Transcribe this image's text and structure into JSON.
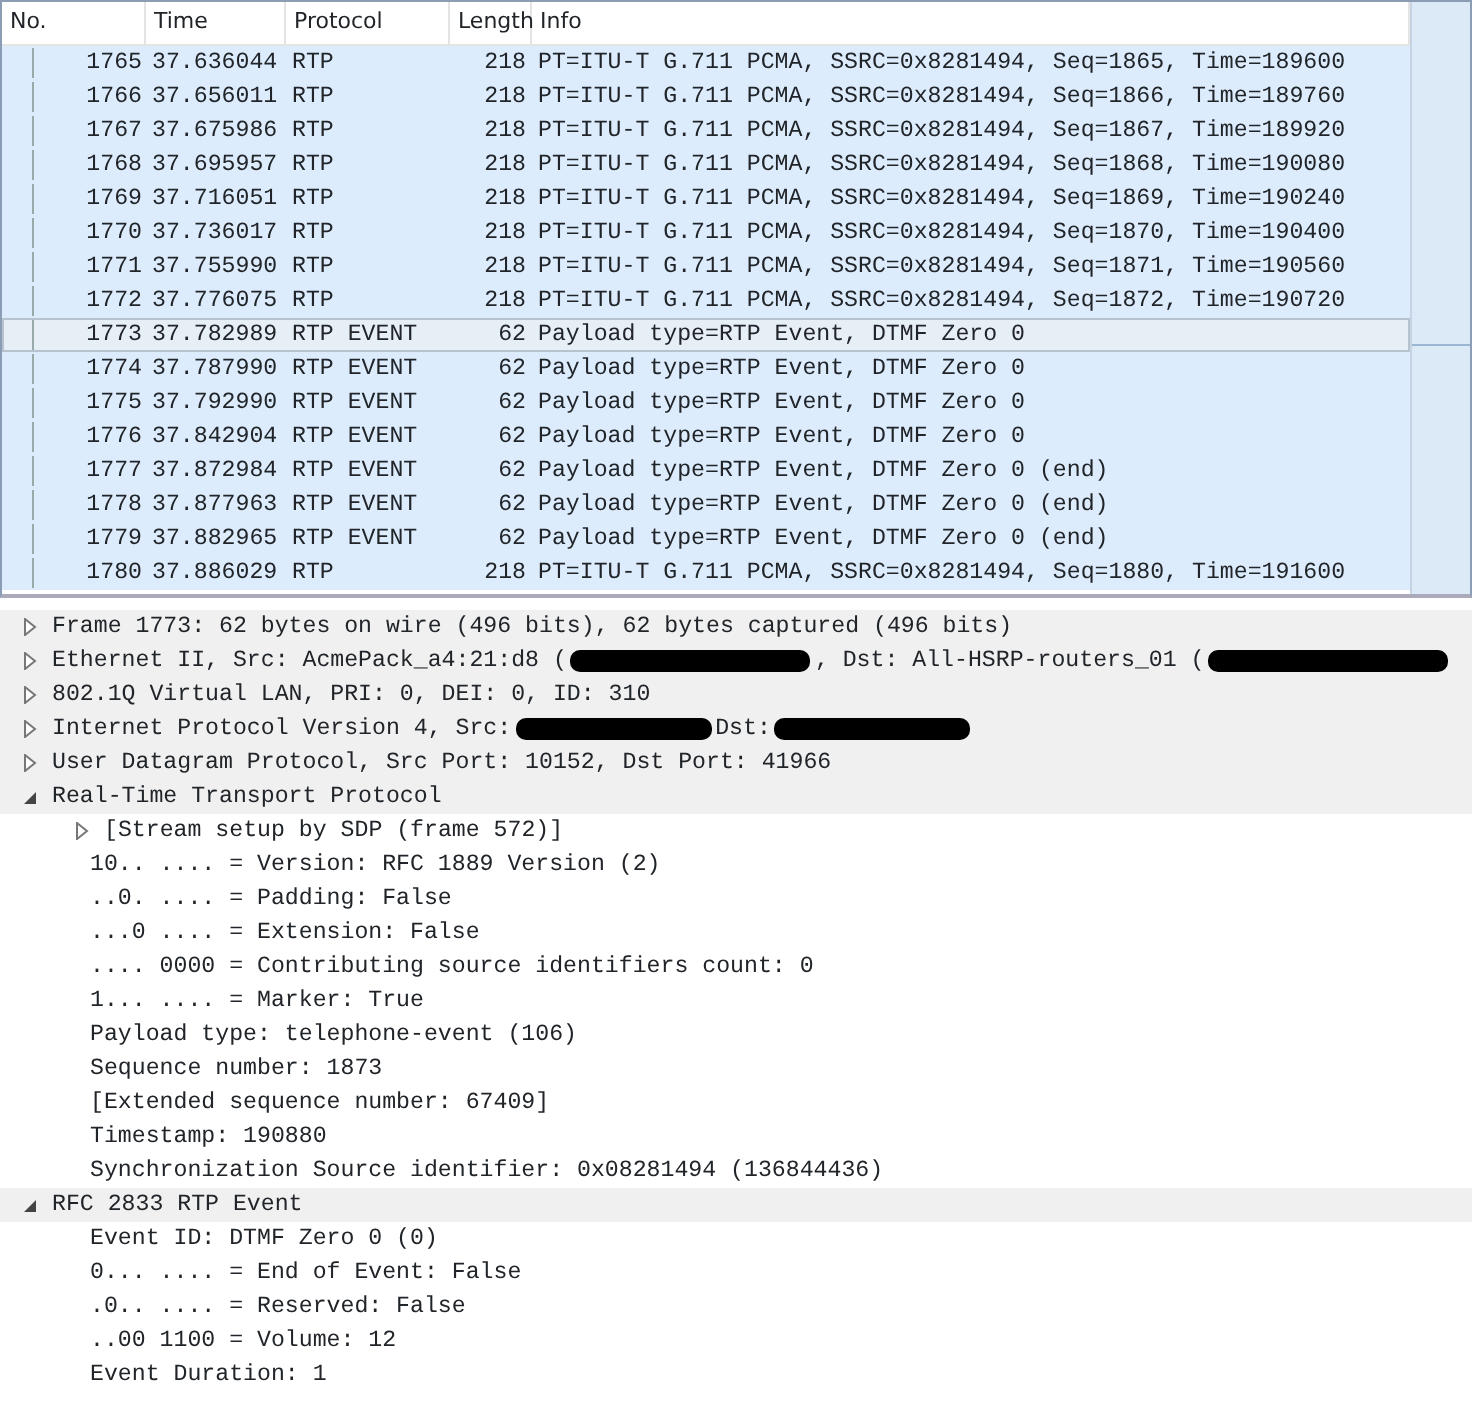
{
  "packet_list": {
    "columns": [
      "No.",
      "Time",
      "Protocol",
      "Length",
      "Info"
    ],
    "rows": [
      {
        "no": "1765",
        "time": "37.636044",
        "protocol": "RTP",
        "length": "218",
        "info": "PT=ITU-T G.711 PCMA, SSRC=0x8281494, Seq=1865, Time=189600",
        "selected": false
      },
      {
        "no": "1766",
        "time": "37.656011",
        "protocol": "RTP",
        "length": "218",
        "info": "PT=ITU-T G.711 PCMA, SSRC=0x8281494, Seq=1866, Time=189760",
        "selected": false
      },
      {
        "no": "1767",
        "time": "37.675986",
        "protocol": "RTP",
        "length": "218",
        "info": "PT=ITU-T G.711 PCMA, SSRC=0x8281494, Seq=1867, Time=189920",
        "selected": false
      },
      {
        "no": "1768",
        "time": "37.695957",
        "protocol": "RTP",
        "length": "218",
        "info": "PT=ITU-T G.711 PCMA, SSRC=0x8281494, Seq=1868, Time=190080",
        "selected": false
      },
      {
        "no": "1769",
        "time": "37.716051",
        "protocol": "RTP",
        "length": "218",
        "info": "PT=ITU-T G.711 PCMA, SSRC=0x8281494, Seq=1869, Time=190240",
        "selected": false
      },
      {
        "no": "1770",
        "time": "37.736017",
        "protocol": "RTP",
        "length": "218",
        "info": "PT=ITU-T G.711 PCMA, SSRC=0x8281494, Seq=1870, Time=190400",
        "selected": false
      },
      {
        "no": "1771",
        "time": "37.755990",
        "protocol": "RTP",
        "length": "218",
        "info": "PT=ITU-T G.711 PCMA, SSRC=0x8281494, Seq=1871, Time=190560",
        "selected": false
      },
      {
        "no": "1772",
        "time": "37.776075",
        "protocol": "RTP",
        "length": "218",
        "info": "PT=ITU-T G.711 PCMA, SSRC=0x8281494, Seq=1872, Time=190720",
        "selected": false
      },
      {
        "no": "1773",
        "time": "37.782989",
        "protocol": "RTP EVENT",
        "length": "62",
        "info": "Payload type=RTP Event, DTMF Zero 0",
        "selected": true
      },
      {
        "no": "1774",
        "time": "37.787990",
        "protocol": "RTP EVENT",
        "length": "62",
        "info": "Payload type=RTP Event, DTMF Zero 0",
        "selected": false
      },
      {
        "no": "1775",
        "time": "37.792990",
        "protocol": "RTP EVENT",
        "length": "62",
        "info": "Payload type=RTP Event, DTMF Zero 0",
        "selected": false
      },
      {
        "no": "1776",
        "time": "37.842904",
        "protocol": "RTP EVENT",
        "length": "62",
        "info": "Payload type=RTP Event, DTMF Zero 0",
        "selected": false
      },
      {
        "no": "1777",
        "time": "37.872984",
        "protocol": "RTP EVENT",
        "length": "62",
        "info": "Payload type=RTP Event, DTMF Zero 0 (end)",
        "selected": false
      },
      {
        "no": "1778",
        "time": "37.877963",
        "protocol": "RTP EVENT",
        "length": "62",
        "info": "Payload type=RTP Event, DTMF Zero 0 (end)",
        "selected": false
      },
      {
        "no": "1779",
        "time": "37.882965",
        "protocol": "RTP EVENT",
        "length": "62",
        "info": "Payload type=RTP Event, DTMF Zero 0 (end)",
        "selected": false
      },
      {
        "no": "1780",
        "time": "37.886029",
        "protocol": "RTP",
        "length": "218",
        "info": "PT=ITU-T G.711 PCMA, SSRC=0x8281494, Seq=1880, Time=191600",
        "selected": false
      }
    ]
  },
  "details": [
    {
      "segments": [
        {
          "kind": "text",
          "text": "Frame 1773: 62 bytes on wire (496 bits), 62 bytes captured (496 bits)"
        }
      ],
      "expanded": false
    },
    {
      "segments": [
        {
          "kind": "text",
          "text": "Ethernet II, Src: AcmePack_a4:21:d8 ("
        },
        {
          "kind": "redacted"
        },
        {
          "kind": "text",
          "text": ", Dst: All-HSRP-routers_01 ("
        },
        {
          "kind": "redacted"
        }
      ],
      "expanded": false
    },
    {
      "segments": [
        {
          "kind": "text",
          "text": "802.1Q Virtual LAN, PRI: 0, DEI: 0, ID: 310"
        }
      ],
      "expanded": false
    },
    {
      "segments": [
        {
          "kind": "text",
          "text": "Internet Protocol Version 4, Src:"
        },
        {
          "kind": "redacted"
        },
        {
          "kind": "text",
          "text": "Dst:"
        },
        {
          "kind": "redacted"
        }
      ],
      "expanded": false
    },
    {
      "segments": [
        {
          "kind": "text",
          "text": "User Datagram Protocol, Src Port: 10152, Dst Port: 41966"
        }
      ],
      "expanded": false
    },
    {
      "segments": [
        {
          "kind": "text",
          "text": "Real-Time Transport Protocol"
        }
      ],
      "expanded": true,
      "children": [
        {
          "segments": [
            {
              "kind": "text",
              "text": "[Stream setup by SDP (frame 572)]"
            }
          ],
          "expanded": false
        },
        {
          "segments": [
            {
              "kind": "text",
              "text": "10.. .... = Version: RFC 1889 Version (2)"
            }
          ]
        },
        {
          "segments": [
            {
              "kind": "text",
              "text": "..0. .... = Padding: False"
            }
          ]
        },
        {
          "segments": [
            {
              "kind": "text",
              "text": "...0 .... = Extension: False"
            }
          ]
        },
        {
          "segments": [
            {
              "kind": "text",
              "text": ".... 0000 = Contributing source identifiers count: 0"
            }
          ]
        },
        {
          "segments": [
            {
              "kind": "text",
              "text": "1... .... = Marker: True"
            }
          ]
        },
        {
          "segments": [
            {
              "kind": "text",
              "text": "Payload type: telephone-event (106)"
            }
          ]
        },
        {
          "segments": [
            {
              "kind": "text",
              "text": "Sequence number: 1873"
            }
          ]
        },
        {
          "segments": [
            {
              "kind": "text",
              "text": "[Extended sequence number: 67409]"
            }
          ]
        },
        {
          "segments": [
            {
              "kind": "text",
              "text": "Timestamp: 190880"
            }
          ]
        },
        {
          "segments": [
            {
              "kind": "text",
              "text": "Synchronization Source identifier: 0x08281494 (136844436)"
            }
          ]
        }
      ]
    },
    {
      "segments": [
        {
          "kind": "text",
          "text": "RFC 2833 RTP Event"
        }
      ],
      "expanded": true,
      "children": [
        {
          "segments": [
            {
              "kind": "text",
              "text": "Event ID: DTMF Zero 0 (0)"
            }
          ]
        },
        {
          "segments": [
            {
              "kind": "text",
              "text": "0... .... = End of Event: False"
            }
          ]
        },
        {
          "segments": [
            {
              "kind": "text",
              "text": ".0.. .... = Reserved: False"
            }
          ]
        },
        {
          "segments": [
            {
              "kind": "text",
              "text": "..00 1100 = Volume: 12"
            }
          ]
        },
        {
          "segments": [
            {
              "kind": "text",
              "text": "Event Duration: 1"
            }
          ]
        }
      ]
    }
  ]
}
